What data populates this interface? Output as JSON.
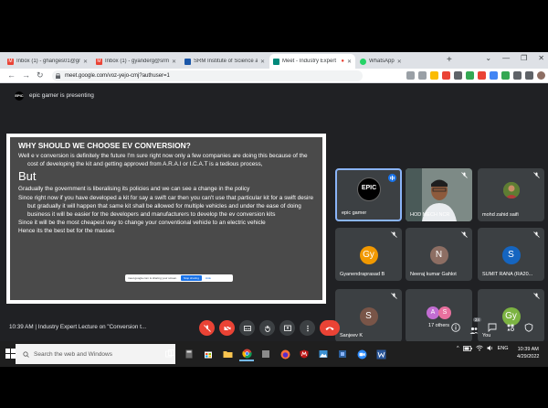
{
  "browser": {
    "tabs": [
      {
        "label": "Inbox (1) - ghanges01@gm...",
        "favicon": "gmail-icon",
        "active": false
      },
      {
        "label": "Inbox (1) - gyanderg@srmist...",
        "favicon": "gmail-icon",
        "active": false
      },
      {
        "label": "SRM Institute of Science and...",
        "favicon": "srm-icon",
        "active": false
      },
      {
        "label": "Meet - Industry Expert L...",
        "favicon": "meet-icon",
        "active": true
      },
      {
        "label": "WhatsApp",
        "favicon": "whatsapp-icon",
        "active": false
      }
    ],
    "url": "meet.google.com/voz-yejo-cmj?authuser=1"
  },
  "meet": {
    "presenter_initials": "EPIC",
    "presenting_text": "epic gamer is presenting",
    "time_title": "10:39 AM  |  Industry Expert Lecture on \"Conversion t...",
    "people_count": "24",
    "share_notice": {
      "text": "meet.google.com is sharing your screen.",
      "stop": "Stop sharing",
      "hide": "Hide"
    },
    "slide": {
      "heading": "WHY SHOULD WE CHOOSE EV CONVERSION?",
      "p1": "Well e v conversion is definitely the future I'm sure right now only a few companies are doing this because of the cost of developing the kit and getting approved from A.R.A.I or I.C.A.T is a tedious process,",
      "big": "But",
      "p2": "Gradually the government is liberalising its policies and we can see a change in the policy",
      "p3": "Since right now if you have developed a kit for say a swift car then you can't use that particular kit for a swift desire but gradually it will happen that same kit shall be allowed for multiple vehicles and under the ease of doing business it will be easier for the developers and manufacturers to develop the ev conversion kits",
      "p4": "Since it will be the most cheapest way to change your conventional vehicle to an electric vehicle",
      "p5": "Hence its the best bet for the masses"
    },
    "participants": [
      {
        "name": "epic gamer",
        "logo_text": "EPIC"
      },
      {
        "name": "HOD MECH NCR"
      },
      {
        "name": "mohd zahid saifi"
      },
      {
        "name": "Gyanendraprasad B",
        "initials": "Gy",
        "color": "#f29900"
      },
      {
        "name": "Neeraj kumar Gahlot",
        "initials": "N",
        "color": "#8d6e63"
      },
      {
        "name": "SUMIT RANA (RA20...",
        "initials": "S",
        "color": "#1565c0"
      },
      {
        "name": "Sanjeev K",
        "initials": "S",
        "color": "#795548"
      },
      {
        "name": "17 others",
        "initials_a": "A",
        "color_a": "#c26dd2",
        "initials_b": "S",
        "color_b": "#e8709e"
      },
      {
        "name": "You",
        "initials": "Gy",
        "color": "#7cb342"
      }
    ]
  },
  "taskbar": {
    "search_placeholder": "Search the web and Windows",
    "lang": "ENG",
    "time": "10:39 AM",
    "date": "4/29/2022"
  }
}
